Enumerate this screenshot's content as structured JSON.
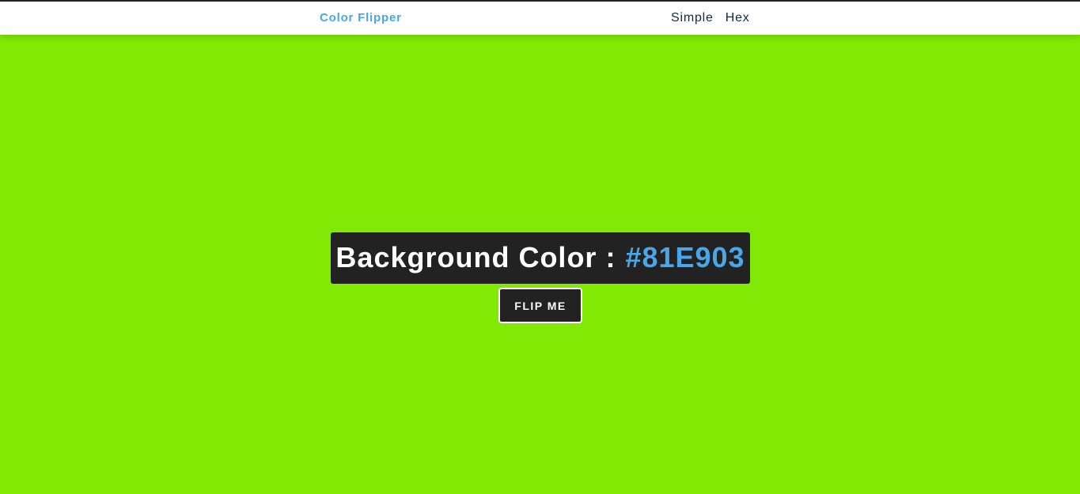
{
  "navbar": {
    "brand": "Color Flipper",
    "links": [
      {
        "label": "Simple"
      },
      {
        "label": "Hex"
      }
    ]
  },
  "main": {
    "label": "Background Color :",
    "value": "#81E903",
    "button_label": "FLIP ME"
  },
  "colors": {
    "background": "#81E903",
    "accent": "#49A6E9",
    "dark": "#222222",
    "nav_text": "#102A42"
  }
}
